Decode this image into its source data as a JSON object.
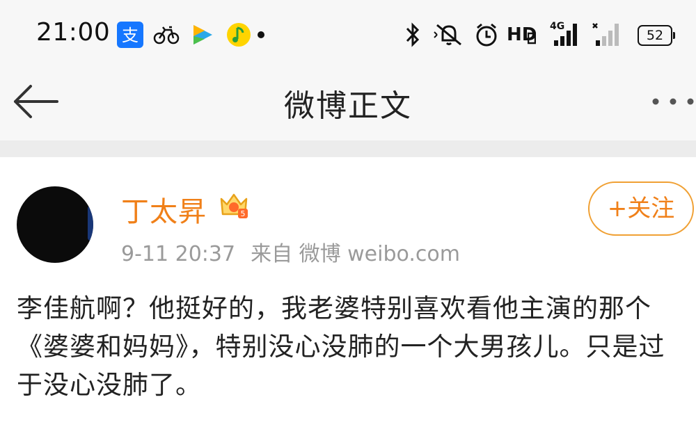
{
  "status_bar": {
    "time": "21:00",
    "notification_icons": [
      "alipay-icon",
      "bike-icon",
      "video-play-icon",
      "music-icon",
      "dot-icon"
    ],
    "system_icons": [
      "bluetooth-icon",
      "mute-icon",
      "alarm-icon",
      "hd-icon",
      "signal-4g-icon",
      "signal-no-sim-icon",
      "battery-icon"
    ],
    "hd_label": "HD",
    "network_label": "4G",
    "battery_level": "52"
  },
  "nav": {
    "title": "微博正文",
    "back_icon": "back-arrow-icon",
    "more_icon": "more-dots-icon"
  },
  "post": {
    "author": "丁太昇",
    "badge_icon": "vip-crown-icon",
    "timestamp": "9-11 20:37",
    "source": "来自 微博 weibo.com",
    "follow_label": "+关注",
    "text": "李佳航啊？他挺好的，我老婆特别喜欢看他主演的那个《婆婆和妈妈》，特别没心没肺的一个大男孩儿。只是过于没心没肺了。"
  },
  "colors": {
    "accent": "#f08019",
    "meta_gray": "#9a9a9a",
    "bar_bg": "#f7f7f7"
  }
}
